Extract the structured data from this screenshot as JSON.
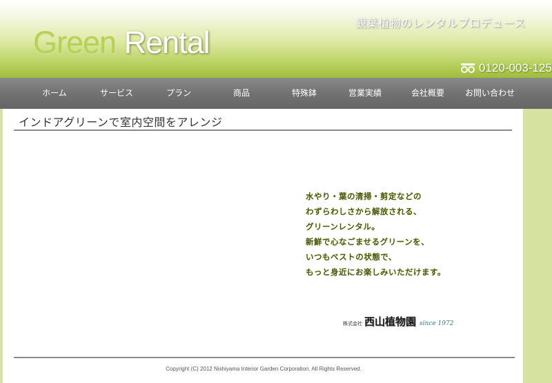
{
  "header": {
    "logo_green": "Green",
    "logo_rental": "Rental",
    "tagline": "観葉植物のレンタルプロデュース",
    "phone": "0120-003-125",
    "phone_icon": "freedial-icon"
  },
  "nav": {
    "items": [
      "ホーム",
      "サービス",
      "プラン",
      "商品",
      "特殊鉢",
      "営業実績",
      "会社概要",
      "お問い合わせ"
    ]
  },
  "main": {
    "title": "インドアグリーンで室内空間をアレンジ",
    "message": [
      "水やり・葉の清掃・剪定などの",
      "わずらわしさから解放される、",
      "グリーンレンタル。",
      "新鮮で心なごませるグリーンを、",
      "いつもベストの状態で、",
      "もっと身近にお楽しみいただけます。"
    ],
    "company_prefix": "株式会社",
    "company_name": "西山植物園",
    "company_since": "since 1972"
  },
  "footer": {
    "copyright": "Copyright (C) 2012 Nishiyama Interior Garden Corporation. All Rights Reserved."
  },
  "colors": {
    "header_green": "#9ebd3b",
    "nav_gray": "#727272",
    "side_band": "#d5e2a0",
    "message_text": "#4a5a10"
  }
}
